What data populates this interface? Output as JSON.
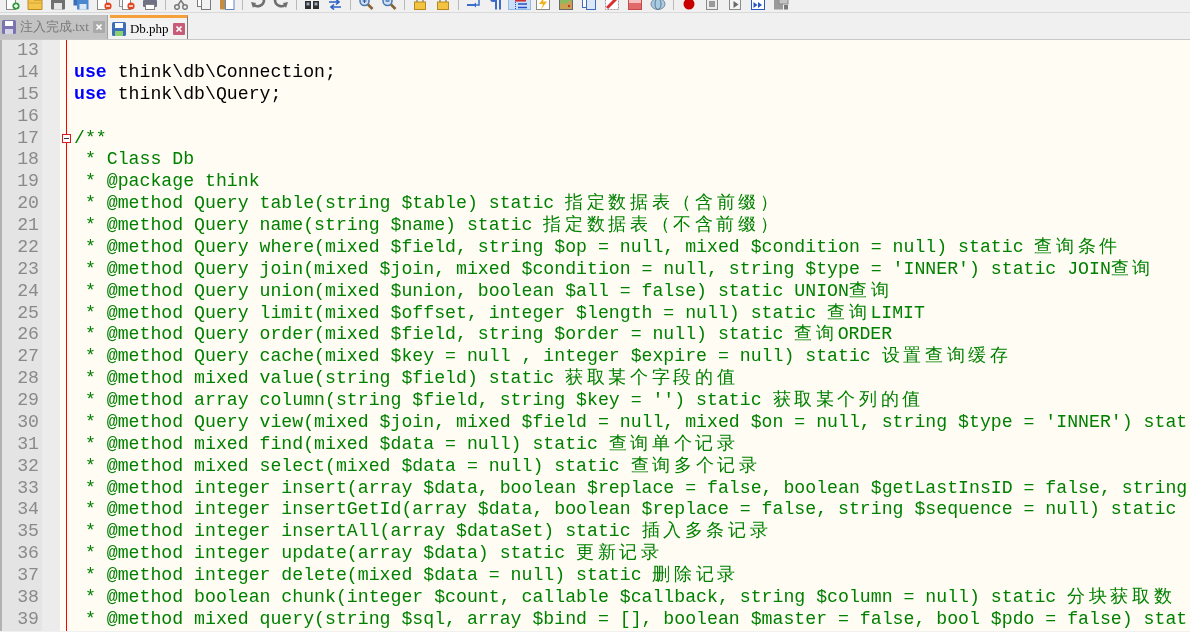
{
  "toolbar": {
    "groups": [
      [
        {
          "checked": false
        },
        {
          "checked": false
        },
        {
          "checked": false
        },
        {
          "checked": false
        },
        {
          "checked": false
        },
        {
          "checked": false
        },
        {
          "checked": false
        }
      ],
      [
        {
          "checked": false
        },
        {
          "checked": false
        },
        {
          "checked": false
        }
      ],
      [
        {
          "checked": false
        },
        {
          "checked": false
        }
      ],
      [
        {
          "checked": false
        },
        {
          "checked": false
        }
      ],
      [
        {
          "checked": false
        },
        {
          "checked": false
        }
      ],
      [
        {
          "checked": false
        },
        {
          "checked": false
        }
      ],
      [
        {
          "checked": false
        },
        {
          "checked": false
        },
        {
          "checked": true
        },
        {
          "checked": false
        },
        {
          "checked": false
        },
        {
          "checked": false
        },
        {
          "checked": false
        },
        {
          "checked": false
        },
        {
          "checked": false
        }
      ],
      [
        {
          "checked": false
        },
        {
          "checked": false
        },
        {
          "checked": false
        },
        {
          "checked": false
        },
        {
          "checked": false
        }
      ]
    ]
  },
  "tabs": [
    {
      "label": "注入完成.txt",
      "selected": false
    },
    {
      "label": "Db.php",
      "selected": true
    }
  ],
  "editor": {
    "lines": [
      {
        "number": "13"
      },
      {
        "number": "14",
        "tokens": [
          {
            "kind": "keyword",
            "text": "use"
          },
          {
            "kind": "plain",
            "text": " think\\db\\Connection;"
          }
        ]
      },
      {
        "number": "15",
        "tokens": [
          {
            "kind": "keyword",
            "text": "use"
          },
          {
            "kind": "plain",
            "text": " think\\db\\Query;"
          }
        ]
      },
      {
        "number": "16"
      },
      {
        "number": "17",
        "fold_marker": {
          "expanded": true
        },
        "tokens": [
          {
            "kind": "comment",
            "text": "/**"
          }
        ]
      },
      {
        "number": "18",
        "tokens": [
          {
            "kind": "comment",
            "text": " * Class Db"
          }
        ]
      },
      {
        "number": "19",
        "tokens": [
          {
            "kind": "comment",
            "text": " * @package think"
          }
        ]
      },
      {
        "number": "20",
        "tokens": [
          {
            "kind": "comment",
            "text": " * @method Query table(string $table) static 指定数据表（含前缀）"
          }
        ]
      },
      {
        "number": "21",
        "tokens": [
          {
            "kind": "comment",
            "text": " * @method Query name(string $name) static 指定数据表（不含前缀）"
          }
        ]
      },
      {
        "number": "22",
        "tokens": [
          {
            "kind": "comment",
            "text": " * @method Query where(mixed $field, string $op = null, mixed $condition = null) static 查询条件"
          }
        ]
      },
      {
        "number": "23",
        "tokens": [
          {
            "kind": "comment",
            "text": " * @method Query join(mixed $join, mixed $condition = null, string $type = 'INNER') static JOIN查询"
          }
        ]
      },
      {
        "number": "24",
        "tokens": [
          {
            "kind": "comment",
            "text": " * @method Query union(mixed $union, boolean $all = false) static UNION查询"
          }
        ]
      },
      {
        "number": "25",
        "tokens": [
          {
            "kind": "comment",
            "text": " * @method Query limit(mixed $offset, integer $length = null) static 查询LIMIT"
          }
        ]
      },
      {
        "number": "26",
        "tokens": [
          {
            "kind": "comment",
            "text": " * @method Query order(mixed $field, string $order = null) static 查询ORDER"
          }
        ]
      },
      {
        "number": "27",
        "tokens": [
          {
            "kind": "comment",
            "text": " * @method Query cache(mixed $key = null , integer $expire = null) static 设置查询缓存"
          }
        ]
      },
      {
        "number": "28",
        "tokens": [
          {
            "kind": "comment",
            "text": " * @method mixed value(string $field) static 获取某个字段的值"
          }
        ]
      },
      {
        "number": "29",
        "tokens": [
          {
            "kind": "comment",
            "text": " * @method array column(string $field, string $key = '') static 获取某个列的值"
          }
        ]
      },
      {
        "number": "30",
        "tokens": [
          {
            "kind": "comment",
            "text": " * @method Query view(mixed $join, mixed $field = null, mixed $on = null, string $type = 'INNER') stat"
          }
        ]
      },
      {
        "number": "31",
        "tokens": [
          {
            "kind": "comment",
            "text": " * @method mixed find(mixed $data = null) static 查询单个记录"
          }
        ]
      },
      {
        "number": "32",
        "tokens": [
          {
            "kind": "comment",
            "text": " * @method mixed select(mixed $data = null) static 查询多个记录"
          }
        ]
      },
      {
        "number": "33",
        "tokens": [
          {
            "kind": "comment",
            "text": " * @method integer insert(array $data, boolean $replace = false, boolean $getLastInsID = false, string"
          }
        ]
      },
      {
        "number": "34",
        "tokens": [
          {
            "kind": "comment",
            "text": " * @method integer insertGetId(array $data, boolean $replace = false, string $sequence = null) static"
          }
        ]
      },
      {
        "number": "35",
        "tokens": [
          {
            "kind": "comment",
            "text": " * @method integer insertAll(array $dataSet) static 插入多条记录"
          }
        ]
      },
      {
        "number": "36",
        "tokens": [
          {
            "kind": "comment",
            "text": " * @method integer update(array $data) static 更新记录"
          }
        ]
      },
      {
        "number": "37",
        "tokens": [
          {
            "kind": "comment",
            "text": " * @method integer delete(mixed $data = null) static 删除记录"
          }
        ]
      },
      {
        "number": "38",
        "tokens": [
          {
            "kind": "comment",
            "text": " * @method boolean chunk(integer $count, callable $callback, string $column = null) static 分块获取数"
          }
        ]
      },
      {
        "number": "39",
        "tokens": [
          {
            "kind": "comment",
            "text": " * @method mixed query(string $sql, array $bind = [], boolean $master = false, bool $pdo = false) stat"
          }
        ]
      }
    ]
  }
}
